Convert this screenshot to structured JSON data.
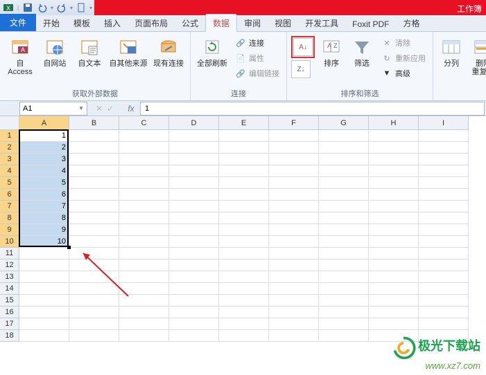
{
  "titlebar": {
    "workbook_name": "工作簿"
  },
  "tabs": {
    "file": "文件",
    "items": [
      "开始",
      "模板",
      "插入",
      "页面布局",
      "公式",
      "数据",
      "审阅",
      "视图",
      "开发工具",
      "Foxit PDF",
      "方格"
    ],
    "active": "数据"
  },
  "ribbon": {
    "groups": {
      "external": {
        "label": "获取外部数据",
        "access": "自 Access",
        "web": "自网站",
        "text": "自文本",
        "other": "自其他来源",
        "existing": "现有连接"
      },
      "connections": {
        "label": "连接",
        "refresh": "全部刷新",
        "conn": "连接",
        "prop": "属性",
        "edit": "编辑链接"
      },
      "sort": {
        "label": "排序和筛选",
        "sort": "排序",
        "filter": "筛选",
        "clear": "清除",
        "reapply": "重新应用",
        "advanced": "高级"
      },
      "tools": {
        "columns": "分列",
        "dedup": "删除\n重复项"
      }
    }
  },
  "namebox": {
    "ref": "A1",
    "formula": "1"
  },
  "grid": {
    "columns": [
      "A",
      "B",
      "C",
      "D",
      "E",
      "F",
      "G",
      "H",
      "I"
    ],
    "row_count": 18,
    "selected_col": "A",
    "selected_rows": [
      1,
      2,
      3,
      4,
      5,
      6,
      7,
      8,
      9,
      10
    ],
    "data_a": [
      "1",
      "2",
      "3",
      "4",
      "5",
      "6",
      "7",
      "8",
      "9",
      "10"
    ]
  },
  "watermark": {
    "name": "极光下载站",
    "url": "www.xz7.com"
  }
}
